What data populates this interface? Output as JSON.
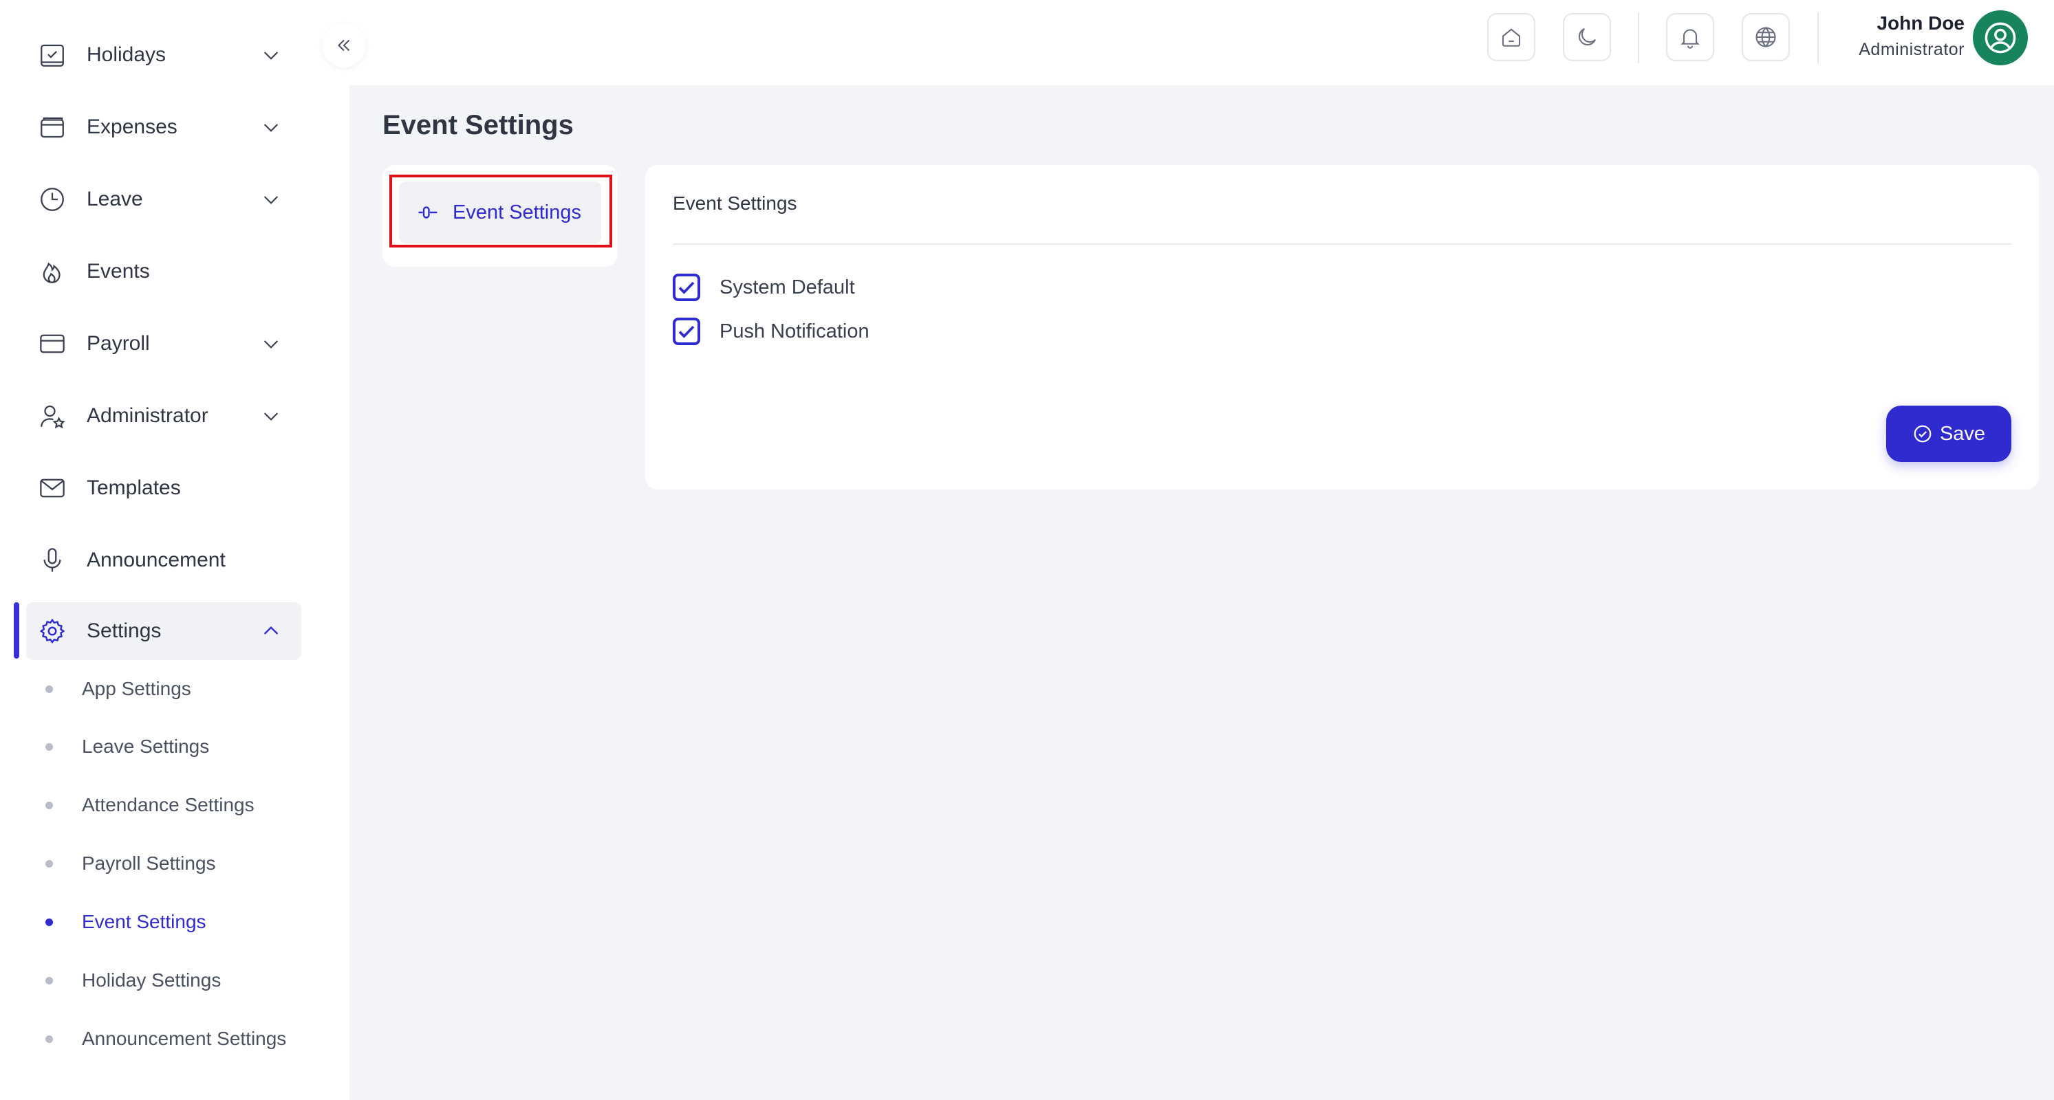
{
  "sidebar": {
    "items": [
      {
        "label": "Holidays",
        "icon": "calendar-check-icon",
        "has_children": true
      },
      {
        "label": "Expenses",
        "icon": "wallet-icon",
        "has_children": true
      },
      {
        "label": "Leave",
        "icon": "clock-icon",
        "has_children": true
      },
      {
        "label": "Events",
        "icon": "flame-icon",
        "has_children": false
      },
      {
        "label": "Payroll",
        "icon": "credit-card-icon",
        "has_children": true
      },
      {
        "label": "Administrator",
        "icon": "user-star-icon",
        "has_children": true
      },
      {
        "label": "Templates",
        "icon": "mail-icon",
        "has_children": false
      },
      {
        "label": "Announcement",
        "icon": "microphone-icon",
        "has_children": false
      },
      {
        "label": "Settings",
        "icon": "gear-icon",
        "has_children": true,
        "expanded": true
      }
    ],
    "settings_sub_items": [
      {
        "label": "App Settings"
      },
      {
        "label": "Leave Settings"
      },
      {
        "label": "Attendance Settings"
      },
      {
        "label": "Payroll Settings"
      },
      {
        "label": "Event Settings",
        "current": true
      },
      {
        "label": "Holiday Settings"
      },
      {
        "label": "Announcement Settings"
      }
    ]
  },
  "topbar": {
    "icons": [
      "home-icon",
      "moon-icon",
      "bell-icon",
      "globe-icon"
    ],
    "user_name": "John Doe",
    "user_role": "Administrator"
  },
  "page": {
    "title": "Event Settings",
    "tab_label": "Event Settings"
  },
  "card": {
    "title": "Event Settings",
    "options": [
      {
        "label": "System Default",
        "checked": true
      },
      {
        "label": "Push Notification",
        "checked": true
      }
    ],
    "save_label": "Save"
  },
  "colors": {
    "accent": "#2f2bcf",
    "avatar": "#17845b",
    "highlight": "#e0101a"
  }
}
